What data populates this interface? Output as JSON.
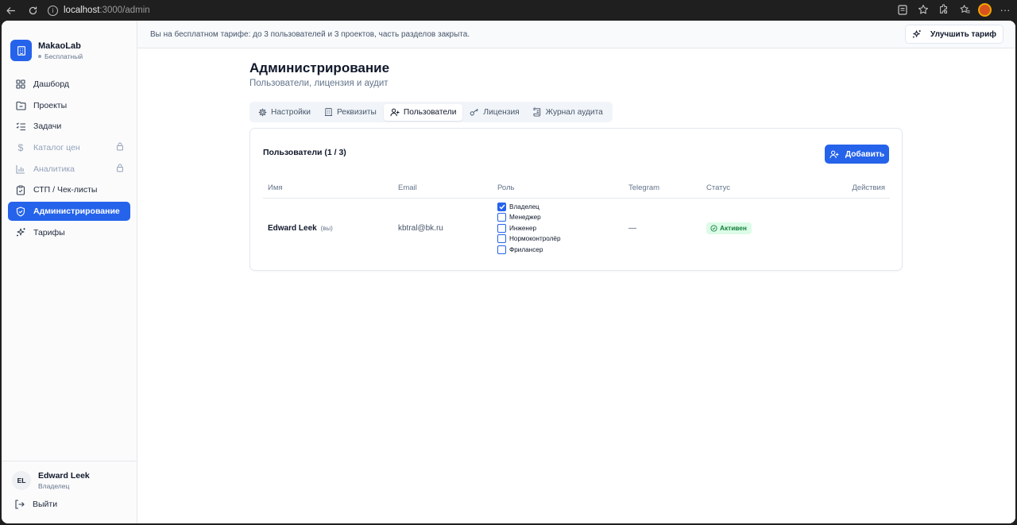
{
  "browser": {
    "url_host": "localhost",
    "url_path": ":3000/admin"
  },
  "sidebar": {
    "brand_name": "MakaoLab",
    "brand_plan": "Бесплатный",
    "items": [
      {
        "label": "Дашборд",
        "icon": "dashboard-icon",
        "locked": false,
        "active": false
      },
      {
        "label": "Проекты",
        "icon": "folder-icon",
        "locked": false,
        "active": false
      },
      {
        "label": "Задачи",
        "icon": "list-check-icon",
        "locked": false,
        "active": false
      },
      {
        "label": "Каталог цен",
        "icon": "dollar-icon",
        "locked": true,
        "active": false
      },
      {
        "label": "Аналитика",
        "icon": "bar-chart-icon",
        "locked": true,
        "active": false
      },
      {
        "label": "СТП / Чек-листы",
        "icon": "clipboard-icon",
        "locked": false,
        "active": false
      },
      {
        "label": "Администрирование",
        "icon": "shield-icon",
        "locked": false,
        "active": true
      },
      {
        "label": "Тарифы",
        "icon": "sparkles-icon",
        "locked": false,
        "active": false
      }
    ],
    "user": {
      "initials": "EL",
      "name": "Edward Leek",
      "role": "Владелец"
    },
    "logout_label": "Выйти"
  },
  "banner": {
    "text": "Вы на бесплатном тарифе: до 3 пользователей и 3 проектов, часть разделов закрыта.",
    "upgrade_label": "Улучшить тариф"
  },
  "page": {
    "title": "Администрирование",
    "subtitle": "Пользователи, лицензия и аудит",
    "tabs": [
      {
        "label": "Настройки",
        "icon": "gear-icon",
        "active": false
      },
      {
        "label": "Реквизиты",
        "icon": "building-icon",
        "active": false
      },
      {
        "label": "Пользователи",
        "icon": "user-plus-icon",
        "active": true
      },
      {
        "label": "Лицензия",
        "icon": "key-icon",
        "active": false
      },
      {
        "label": "Журнал аудита",
        "icon": "scroll-icon",
        "active": false
      }
    ]
  },
  "users_card": {
    "title": "Пользователи (1 / 3)",
    "add_label": "Добавить",
    "columns": {
      "name": "Имя",
      "email": "Email",
      "role": "Роль",
      "telegram": "Telegram",
      "status": "Статус",
      "actions": "Действия"
    },
    "rows": [
      {
        "name": "Edward Leek",
        "you": "(вы)",
        "email": "kbtral@bk.ru",
        "roles": [
          {
            "label": "Владелец",
            "checked": true
          },
          {
            "label": "Менеджер",
            "checked": false
          },
          {
            "label": "Инженер",
            "checked": false
          },
          {
            "label": "Нормоконтролёр",
            "checked": false
          },
          {
            "label": "Фрилансер",
            "checked": false
          }
        ],
        "telegram": "—",
        "status": "Активен"
      }
    ]
  },
  "colors": {
    "accent": "#2563eb",
    "status_active_bg": "#dcfce7",
    "status_active_text": "#15803d"
  }
}
